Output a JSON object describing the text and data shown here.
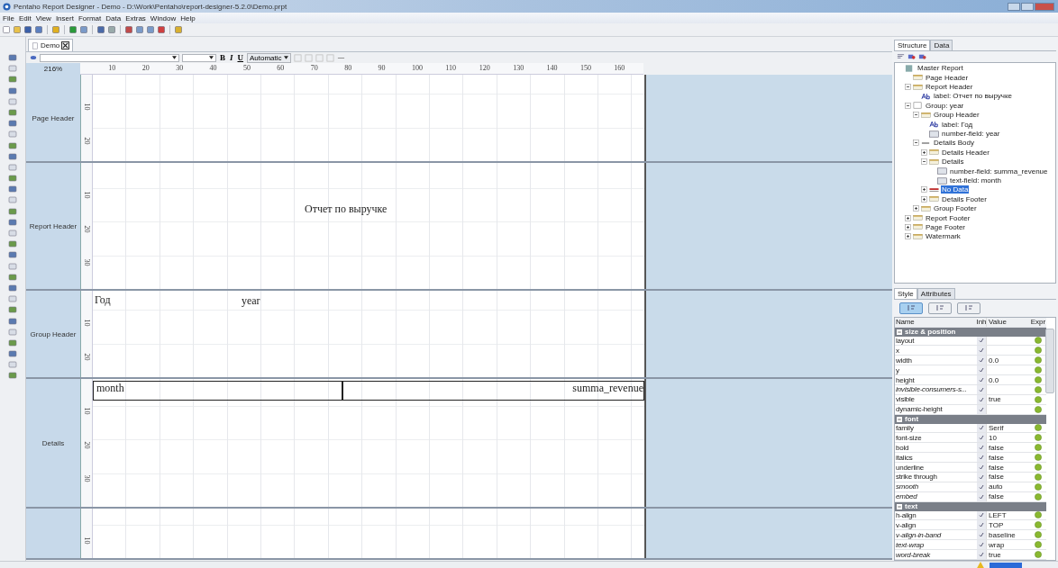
{
  "window": {
    "title": "Pentaho Report Designer - Demo - D:\\Work\\Pentaho\\report-designer-5.2.0\\Demo.prpt"
  },
  "menu": [
    "File",
    "Edit",
    "View",
    "Insert",
    "Format",
    "Data",
    "Extras",
    "Window",
    "Help"
  ],
  "document_tab": {
    "label": "Demo",
    "selected": true
  },
  "format_toolbar": {
    "bold": "B",
    "italic": "I",
    "underline": "U",
    "color_label": "Automatic"
  },
  "zoom": "216%",
  "ruler": [
    "10",
    "20",
    "30",
    "40",
    "50",
    "60",
    "70",
    "80",
    "90",
    "100",
    "110",
    "120",
    "130",
    "140",
    "150",
    "160"
  ],
  "bands": [
    {
      "label": "Page Header",
      "ruler": [
        "10",
        "20"
      ]
    },
    {
      "label": "Report Header",
      "ruler": [
        "10",
        "20",
        "30"
      ],
      "elements": [
        {
          "kind": "title",
          "text": "Отчет по выручке"
        }
      ]
    },
    {
      "label": "Group Header",
      "ruler": [
        "10",
        "20"
      ],
      "elements": [
        {
          "kind": "label",
          "text": "Год"
        },
        {
          "kind": "field",
          "text": "year"
        }
      ]
    },
    {
      "label": "Details",
      "ruler": [
        "10",
        "20",
        "30"
      ],
      "elements": [
        {
          "kind": "cell",
          "text": "month"
        },
        {
          "kind": "cell-right",
          "text": "summa_revenue"
        }
      ]
    },
    {
      "ruler": [
        "10"
      ]
    }
  ],
  "structure": {
    "tabs": [
      {
        "label": "Structure",
        "selected": true
      },
      {
        "label": "Data",
        "selected": false
      }
    ],
    "tree": [
      {
        "label": "Master Report",
        "kind": "report",
        "selected": false,
        "children": [
          {
            "label": "Page Header",
            "kind": "band",
            "selected": false
          },
          {
            "label": "Report Header",
            "kind": "band",
            "selected": false,
            "expanded": true,
            "children": [
              {
                "label": "label: Отчет по выручке",
                "kind": "label",
                "selected": false
              }
            ]
          },
          {
            "label": "Group: year",
            "kind": "group",
            "selected": false,
            "expanded": true,
            "children": [
              {
                "label": "Group Header",
                "kind": "band",
                "selected": false,
                "expanded": true,
                "children": [
                  {
                    "label": "label: Год",
                    "kind": "label",
                    "selected": false
                  },
                  {
                    "label": "number-field: year",
                    "kind": "field",
                    "selected": false
                  }
                ]
              },
              {
                "label": "Details Body",
                "kind": "body",
                "selected": false,
                "expanded": true,
                "children": [
                  {
                    "label": "Details Header",
                    "kind": "band",
                    "selected": false,
                    "expanded": false
                  },
                  {
                    "label": "Details",
                    "kind": "band",
                    "selected": false,
                    "expanded": true,
                    "children": [
                      {
                        "label": "number-field: summa_revenue",
                        "kind": "field",
                        "selected": false
                      },
                      {
                        "label": "text-field: month",
                        "kind": "field",
                        "selected": false
                      }
                    ]
                  },
                  {
                    "label": "No Data",
                    "kind": "nodata",
                    "selected": true,
                    "expanded": false
                  },
                  {
                    "label": "Details Footer",
                    "kind": "band",
                    "selected": false,
                    "expanded": false
                  }
                ]
              },
              {
                "label": "Group Footer",
                "kind": "band",
                "selected": false,
                "expanded": false
              }
            ]
          },
          {
            "label": "Report Footer",
            "kind": "band",
            "selected": false,
            "expanded": false
          },
          {
            "label": "Page Footer",
            "kind": "band",
            "selected": false,
            "expanded": false
          },
          {
            "label": "Watermark",
            "kind": "band",
            "selected": false,
            "expanded": false
          }
        ]
      }
    ]
  },
  "properties": {
    "tabs": [
      {
        "label": "Style",
        "selected": true
      },
      {
        "label": "Attributes",
        "selected": false
      }
    ],
    "view_buttons": [
      {
        "selected": true
      },
      {
        "selected": false
      },
      {
        "selected": false
      }
    ],
    "columns": [
      "Name",
      "Inh",
      "Value",
      "Expr"
    ],
    "rows": [
      {
        "kind": "section",
        "name": "size & position"
      },
      {
        "kind": "row",
        "name": "layout",
        "inherit": true,
        "italic": false
      },
      {
        "kind": "row",
        "name": "x",
        "inherit": true,
        "italic": false
      },
      {
        "kind": "row",
        "name": "width",
        "inherit": true,
        "italic": false,
        "value": "0.0"
      },
      {
        "kind": "row",
        "name": "y",
        "inherit": true,
        "italic": false
      },
      {
        "kind": "row",
        "name": "height",
        "inherit": true,
        "italic": false,
        "value": "0.0"
      },
      {
        "kind": "row",
        "name": "invisible-consumers-s...",
        "inherit": true,
        "italic": true
      },
      {
        "kind": "row",
        "name": "visible",
        "inherit": true,
        "italic": false,
        "value": "true"
      },
      {
        "kind": "row",
        "name": "dynamic-height",
        "inherit": true,
        "italic": false
      },
      {
        "kind": "section",
        "name": "font"
      },
      {
        "kind": "row",
        "name": "family",
        "inherit": true,
        "italic": false,
        "value": "Serif"
      },
      {
        "kind": "row",
        "name": "font-size",
        "inherit": true,
        "italic": false,
        "value": "10"
      },
      {
        "kind": "row",
        "name": "bold",
        "inherit": true,
        "italic": false,
        "value": "false"
      },
      {
        "kind": "row",
        "name": "italics",
        "inherit": true,
        "italic": false,
        "value": "false"
      },
      {
        "kind": "row",
        "name": "underline",
        "inherit": true,
        "italic": false,
        "value": "false"
      },
      {
        "kind": "row",
        "name": "strike through",
        "inherit": true,
        "italic": false,
        "value": "false"
      },
      {
        "kind": "row",
        "name": "smooth",
        "inherit": true,
        "italic": true,
        "value": "auto"
      },
      {
        "kind": "row",
        "name": "embed",
        "inherit": true,
        "italic": true,
        "value": "false"
      },
      {
        "kind": "section",
        "name": "text"
      },
      {
        "kind": "row",
        "name": "h-align",
        "inherit": true,
        "italic": false,
        "value": "LEFT"
      },
      {
        "kind": "row",
        "name": "v-align",
        "inherit": true,
        "italic": false,
        "value": "TOP"
      },
      {
        "kind": "row",
        "name": "v-align-in-band",
        "inherit": true,
        "italic": true,
        "value": "baseline"
      },
      {
        "kind": "row",
        "name": "text-wrap",
        "inherit": true,
        "italic": true,
        "value": "wrap"
      },
      {
        "kind": "row",
        "name": "word-break",
        "inherit": true,
        "italic": true,
        "value": "true"
      }
    ]
  }
}
